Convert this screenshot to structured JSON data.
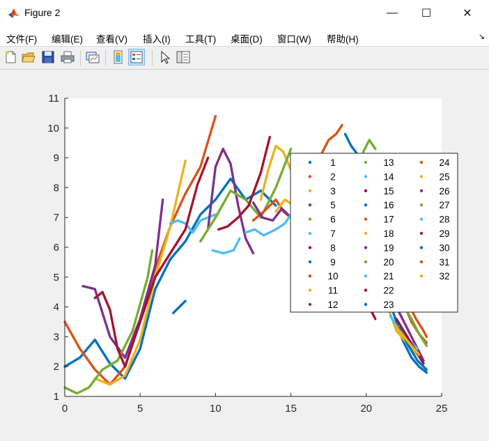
{
  "window": {
    "title": "Figure 2",
    "minimize_glyph": "—",
    "maximize_glyph": "☐",
    "close_glyph": "✕",
    "icon": "matlab-icon"
  },
  "menu": [
    "文件(F)",
    "编辑(E)",
    "查看(V)",
    "插入(I)",
    "工具(T)",
    "桌面(D)",
    "窗口(W)",
    "帮助(H)"
  ],
  "toolbar": [
    "new-figure-icon",
    "open-icon",
    "save-icon",
    "print-icon",
    "link-plot-icon",
    "colorbar-icon",
    "legend-icon",
    "pointer-icon",
    "property-inspector-icon"
  ],
  "chart_data": {
    "type": "scatter",
    "title": "",
    "xlabel": "",
    "ylabel": "",
    "xlim": [
      0,
      25
    ],
    "ylim": [
      1,
      11
    ],
    "xticks": [
      0,
      5,
      10,
      15,
      20,
      25
    ],
    "yticks": [
      1,
      2,
      3,
      4,
      5,
      6,
      7,
      8,
      9,
      10,
      11
    ],
    "grid": false,
    "legend_position": "right",
    "palette": [
      "#0072BD",
      "#D95319",
      "#EDB120",
      "#7E2F8E",
      "#77AC30",
      "#4DBEEE",
      "#A2142F"
    ],
    "series": [
      {
        "name": "1",
        "color": "#0072BD",
        "points": [
          [
            0,
            2.0
          ],
          [
            1,
            2.3
          ],
          [
            2,
            2.9
          ],
          [
            3,
            2.1
          ],
          [
            4,
            1.6
          ],
          [
            5,
            2.6
          ],
          [
            6,
            4.6
          ],
          [
            7,
            5.6
          ],
          [
            8,
            6.2
          ],
          [
            9,
            7.1
          ],
          [
            10,
            7.6
          ],
          [
            11,
            8.3
          ],
          [
            12,
            7.6
          ],
          [
            13,
            7.9
          ],
          [
            14,
            7.4
          ]
        ]
      },
      {
        "name": "2",
        "color": "#D95319",
        "points": [
          [
            0,
            3.5
          ],
          [
            1,
            2.6
          ],
          [
            2,
            1.9
          ],
          [
            3,
            1.4
          ],
          [
            4,
            2.0
          ],
          [
            5,
            3.6
          ],
          [
            6,
            5.3
          ],
          [
            7,
            6.7
          ],
          [
            8,
            7.8
          ],
          [
            9,
            8.7
          ],
          [
            10,
            10.4
          ]
        ]
      },
      {
        "name": "3",
        "color": "#EDB120",
        "points": [
          [
            2,
            1.6
          ],
          [
            3,
            1.4
          ],
          [
            4,
            1.7
          ],
          [
            5,
            2.9
          ],
          [
            6,
            5.0
          ],
          [
            7,
            6.7
          ],
          [
            8,
            8.9
          ]
        ]
      },
      {
        "name": "5",
        "color": "#7E2F8E",
        "points": [
          [
            1.2,
            4.7
          ],
          [
            2,
            4.6
          ],
          [
            3,
            3.0
          ],
          [
            4,
            2.3
          ],
          [
            5,
            3.6
          ],
          [
            6,
            5.4
          ],
          [
            6.5,
            7.6
          ]
        ]
      },
      {
        "name": "6",
        "color": "#77AC30",
        "points": [
          [
            0,
            1.3
          ],
          [
            0.8,
            1.1
          ],
          [
            1.6,
            1.3
          ],
          [
            2.5,
            1.9
          ],
          [
            3.5,
            2.2
          ],
          [
            4.5,
            3.2
          ],
          [
            5.5,
            5.0
          ],
          [
            5.8,
            5.9
          ]
        ]
      },
      {
        "name": "7",
        "color": "#4DBEEE",
        "points": [
          [
            7,
            6.8
          ],
          [
            7.5,
            6.9
          ],
          [
            8,
            6.8
          ],
          [
            8.5,
            6.5
          ],
          [
            9,
            6.9
          ],
          [
            9.5,
            7.0
          ],
          [
            10,
            7.1
          ]
        ]
      },
      {
        "name": "8",
        "color": "#A2142F",
        "points": [
          [
            2,
            4.3
          ],
          [
            2.5,
            4.5
          ],
          [
            3,
            3.9
          ],
          [
            3.5,
            2.6
          ],
          [
            4,
            2.0
          ],
          [
            5,
            3.5
          ],
          [
            6,
            5.0
          ],
          [
            7,
            5.8
          ],
          [
            8,
            6.6
          ],
          [
            8.8,
            8.1
          ],
          [
            9.5,
            9.0
          ]
        ]
      },
      {
        "name": "9",
        "color": "#0072BD",
        "points": [
          [
            7.2,
            3.8
          ],
          [
            7.6,
            4.0
          ],
          [
            8,
            4.2
          ]
        ]
      },
      {
        "name": "10",
        "color": "#D95319",
        "points": [
          [
            15,
            7.1
          ],
          [
            15.5,
            7.5
          ],
          [
            16,
            8.0
          ],
          [
            17,
            9.1
          ],
          [
            17.5,
            9.6
          ],
          [
            18,
            9.8
          ],
          [
            18.4,
            10.1
          ]
        ]
      },
      {
        "name": "11",
        "color": "#EDB120",
        "points": [
          [
            13,
            7.6
          ],
          [
            13.5,
            8.6
          ],
          [
            14,
            9.4
          ],
          [
            14.5,
            9.2
          ],
          [
            15,
            8.6
          ],
          [
            15.5,
            7.9
          ],
          [
            16,
            7.1
          ],
          [
            16.5,
            6.5
          ]
        ]
      },
      {
        "name": "12",
        "color": "#7E2F8E",
        "points": [
          [
            9.5,
            6.6
          ],
          [
            10,
            8.7
          ],
          [
            10.5,
            9.3
          ],
          [
            11,
            8.8
          ],
          [
            11.5,
            7.4
          ],
          [
            12,
            6.3
          ],
          [
            12.5,
            5.8
          ]
        ]
      },
      {
        "name": "13",
        "color": "#77AC30",
        "points": [
          [
            9,
            6.2
          ],
          [
            10,
            7.0
          ],
          [
            11,
            7.9
          ],
          [
            12,
            7.6
          ],
          [
            13,
            7.0
          ],
          [
            14,
            8.0
          ],
          [
            15,
            9.3
          ]
        ]
      },
      {
        "name": "14",
        "color": "#4DBEEE",
        "points": [
          [
            9.8,
            5.9
          ],
          [
            10.5,
            5.8
          ],
          [
            11.2,
            5.9
          ],
          [
            11.6,
            6.3
          ]
        ]
      },
      {
        "name": "15",
        "color": "#A2142F",
        "points": [
          [
            10.2,
            6.6
          ],
          [
            10.8,
            6.7
          ],
          [
            11.5,
            7.0
          ],
          [
            12.2,
            7.4
          ],
          [
            13,
            8.5
          ],
          [
            13.6,
            9.7
          ]
        ]
      },
      {
        "name": "16",
        "color": "#0072BD",
        "points": [
          [
            18.6,
            9.8
          ],
          [
            19,
            9.4
          ],
          [
            19.6,
            9.0
          ],
          [
            20.2,
            8.7
          ]
        ]
      },
      {
        "name": "17",
        "color": "#D95319",
        "points": [
          [
            12.5,
            6.9
          ],
          [
            13.2,
            7.2
          ],
          [
            14,
            7.6
          ],
          [
            14.5,
            7.2
          ],
          [
            15,
            7.0
          ]
        ]
      },
      {
        "name": "18",
        "color": "#EDB120",
        "points": [
          [
            14,
            7.2
          ],
          [
            14.6,
            7.6
          ],
          [
            15.2,
            7.4
          ],
          [
            15.6,
            7.0
          ]
        ]
      },
      {
        "name": "19",
        "color": "#7E2F8E",
        "points": [
          [
            12.5,
            7.5
          ],
          [
            13.1,
            7.0
          ],
          [
            13.8,
            6.9
          ],
          [
            14.4,
            7.3
          ],
          [
            15,
            7.0
          ]
        ]
      },
      {
        "name": "20",
        "color": "#77AC30",
        "points": [
          [
            19.8,
            9.2
          ],
          [
            20.2,
            9.6
          ],
          [
            20.6,
            9.3
          ]
        ]
      },
      {
        "name": "21",
        "color": "#4DBEEE",
        "points": [
          [
            12,
            6.5
          ],
          [
            12.6,
            6.6
          ],
          [
            13.2,
            6.4
          ],
          [
            14,
            6.6
          ],
          [
            14.6,
            6.8
          ],
          [
            15,
            7.1
          ]
        ]
      },
      {
        "name": "22",
        "color": "#A2142F",
        "points": [
          [
            19.8,
            4.2
          ],
          [
            20.2,
            4.0
          ],
          [
            20.6,
            3.6
          ]
        ]
      },
      {
        "name": "23",
        "color": "#0072BD",
        "points": [
          [
            21.8,
            3.8
          ],
          [
            22.4,
            2.9
          ],
          [
            23,
            2.3
          ],
          [
            23.5,
            2.0
          ],
          [
            24,
            1.8
          ]
        ]
      },
      {
        "name": "24",
        "color": "#D95319",
        "points": [
          [
            22.5,
            4.1
          ],
          [
            23,
            3.5
          ],
          [
            23.5,
            3.1
          ],
          [
            24,
            2.8
          ]
        ]
      },
      {
        "name": "25",
        "color": "#EDB120",
        "points": [
          [
            21.5,
            3.9
          ],
          [
            22,
            3.2
          ],
          [
            22.5,
            2.9
          ],
          [
            23,
            2.6
          ],
          [
            23.6,
            2.3
          ]
        ]
      },
      {
        "name": "26",
        "color": "#7E2F8E",
        "points": [
          [
            22,
            4.0
          ],
          [
            22.6,
            3.4
          ],
          [
            23.2,
            2.8
          ],
          [
            23.8,
            2.2
          ]
        ]
      },
      {
        "name": "27",
        "color": "#77AC30",
        "points": [
          [
            22.4,
            4.1
          ],
          [
            23,
            3.6
          ],
          [
            23.5,
            3.1
          ],
          [
            24,
            2.7
          ]
        ]
      },
      {
        "name": "28",
        "color": "#4DBEEE",
        "points": [
          [
            21.6,
            3.7
          ],
          [
            22.2,
            3.2
          ],
          [
            22.8,
            2.9
          ],
          [
            23.4,
            2.6
          ]
        ]
      },
      {
        "name": "29",
        "color": "#A2142F",
        "points": [
          [
            22,
            3.6
          ],
          [
            22.6,
            3.1
          ],
          [
            23.2,
            2.6
          ],
          [
            23.8,
            2.1
          ]
        ]
      },
      {
        "name": "30",
        "color": "#0072BD",
        "points": [
          [
            22.2,
            3.3
          ],
          [
            22.8,
            2.7
          ],
          [
            23.4,
            2.2
          ],
          [
            24,
            1.9
          ]
        ]
      },
      {
        "name": "31",
        "color": "#D95319",
        "points": [
          [
            22.8,
            4.1
          ],
          [
            23.3,
            3.6
          ],
          [
            23.8,
            3.2
          ],
          [
            24,
            3.0
          ]
        ]
      },
      {
        "name": "32",
        "color": "#EDB120",
        "points": [
          [
            21.9,
            3.4
          ],
          [
            22.5,
            3.0
          ],
          [
            23,
            2.7
          ],
          [
            23.5,
            2.4
          ]
        ]
      }
    ]
  }
}
